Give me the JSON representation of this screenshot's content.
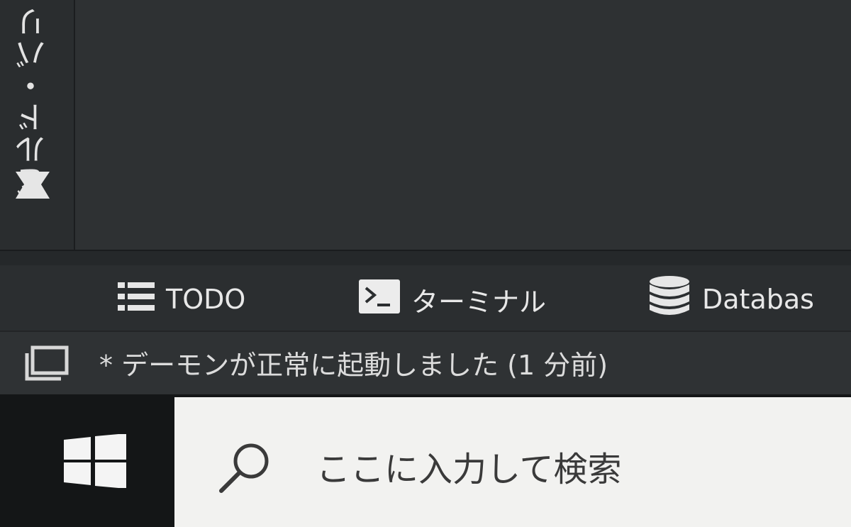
{
  "left_stripe": {
    "label": "ビルド・バリ"
  },
  "tool_windows": [
    {
      "label": "TODO",
      "icon": "list-icon"
    },
    {
      "label": "ターミナル",
      "icon": "terminal-icon"
    },
    {
      "label": "Databas",
      "icon": "database-icon"
    }
  ],
  "status_bar": {
    "message": "* デーモンが正常に起動しました (1 分前)",
    "icon": "window-toggle-icon"
  },
  "taskbar": {
    "start_icon": "windows-start-icon",
    "search": {
      "placeholder": "ここに入力して検索",
      "icon": "search-icon"
    }
  },
  "colors": {
    "editor_bg": "#2e3133",
    "toolwindow_bg": "#2b2e30",
    "status_bg": "#2f3234",
    "taskbar_bg": "#141617",
    "search_bg": "#f2f2f0",
    "text": "#e8e8e8"
  }
}
